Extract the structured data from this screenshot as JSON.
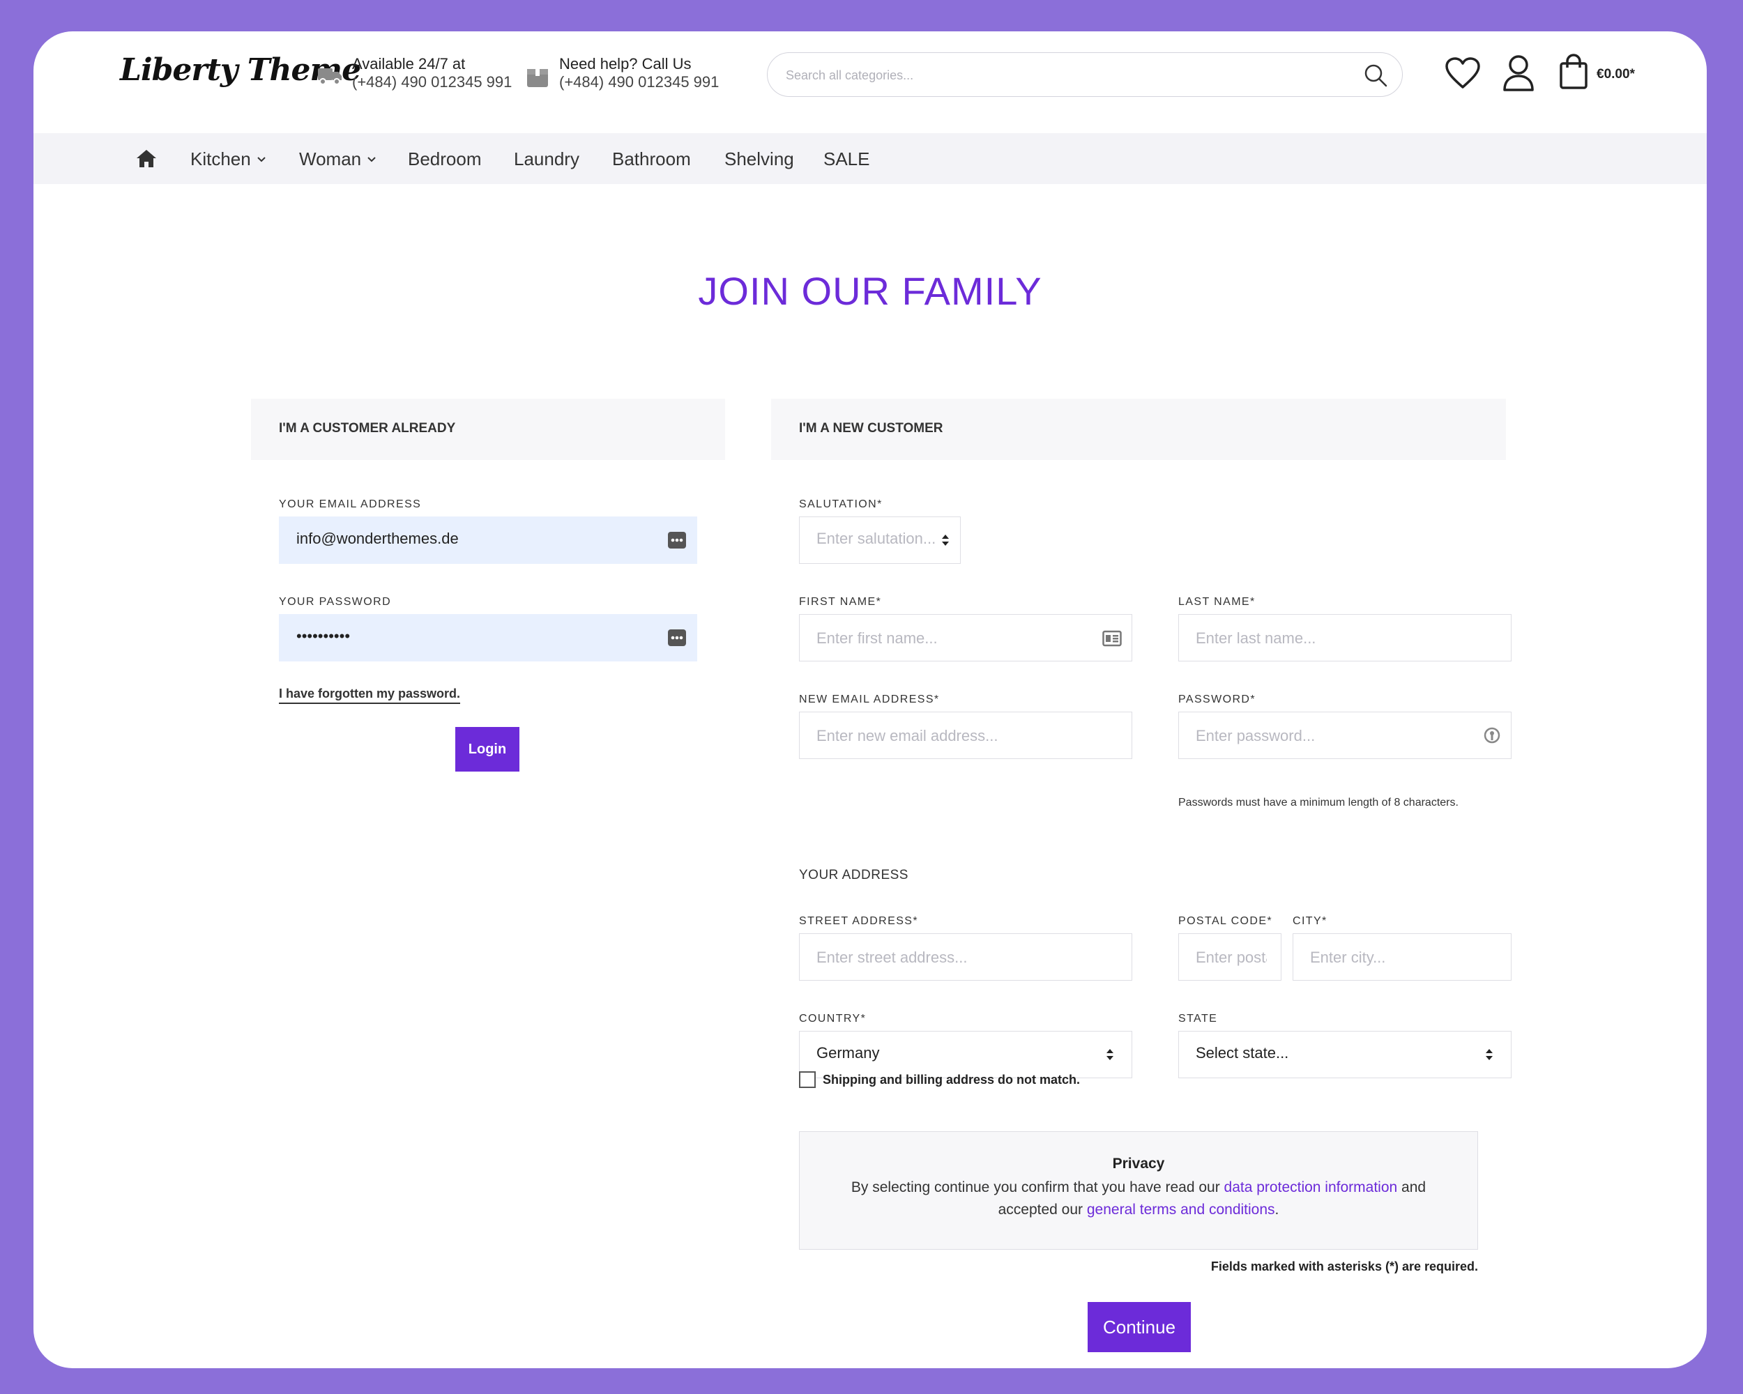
{
  "header": {
    "logo": "Liberty Theme",
    "shipping_line1": "Available 24/7 at",
    "shipping_line2": "(+484) 490 012345 991",
    "help_line1": "Need help? Call Us",
    "help_line2": "(+484) 490 012345 991",
    "search_placeholder": "Search all categories...",
    "cart_amount": "€0.00*"
  },
  "nav": {
    "items": [
      {
        "label": "Kitchen",
        "has_dropdown": true
      },
      {
        "label": "Woman",
        "has_dropdown": true
      },
      {
        "label": "Bedroom"
      },
      {
        "label": "Laundry"
      },
      {
        "label": "Bathroom"
      },
      {
        "label": "Shelving"
      },
      {
        "label": "SALE"
      }
    ]
  },
  "page": {
    "title": "JOIN OUR FAMILY"
  },
  "login": {
    "heading": "I'M A CUSTOMER ALREADY",
    "email_label": "YOUR EMAIL ADDRESS",
    "email_value": "info@wonderthemes.de",
    "password_label": "YOUR PASSWORD",
    "password_value": "••••••••••",
    "forgot": "I have forgotten my password.",
    "login_button": "Login"
  },
  "register": {
    "heading": "I'M A NEW CUSTOMER",
    "salutation_label": "SALUTATION*",
    "salutation_placeholder": "Enter salutation...",
    "first_name_label": "FIRST NAME*",
    "first_name_placeholder": "Enter first name...",
    "last_name_label": "LAST NAME*",
    "last_name_placeholder": "Enter last name...",
    "email_label": "NEW EMAIL ADDRESS*",
    "email_placeholder": "Enter new email address...",
    "password_label": "PASSWORD*",
    "password_placeholder": "Enter password...",
    "password_hint": "Passwords must have a minimum length of 8 characters.",
    "address_section": "YOUR ADDRESS",
    "street_label": "STREET ADDRESS*",
    "street_placeholder": "Enter street address...",
    "postal_label": "POSTAL CODE*",
    "postal_placeholder": "Enter postal code...",
    "city_label": "CITY*",
    "city_placeholder": "Enter city...",
    "country_label": "COUNTRY*",
    "country_value": "Germany",
    "state_label": "STATE",
    "state_value": "Select state...",
    "shipping_checkbox": "Shipping and billing address do not match.",
    "privacy_title": "Privacy",
    "privacy_text_1": "By selecting continue you confirm that you have read our ",
    "privacy_link_1": "data protection information",
    "privacy_text_2": " and accepted our ",
    "privacy_link_2": "general terms and conditions",
    "privacy_text_3": ".",
    "required_note": "Fields marked with asterisks (*) are required.",
    "continue_button": "Continue"
  },
  "colors": {
    "accent": "#6c2bd9",
    "background": "#8b6fd9",
    "autofill": "#e8f0fe"
  }
}
